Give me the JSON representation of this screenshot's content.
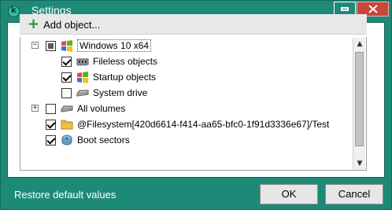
{
  "window": {
    "title": "Settings"
  },
  "toolbar": {
    "add_label": "Add object..."
  },
  "tree": {
    "items": [
      {
        "label": "Windows 10 x64",
        "check": "partial",
        "expander": "-",
        "icon": "windows-flag-icon",
        "selected": true
      },
      {
        "label": "Fileless objects",
        "check": "checked",
        "icon": "memory-chip-icon"
      },
      {
        "label": "Startup objects",
        "check": "checked",
        "icon": "windows-flag-icon"
      },
      {
        "label": "System drive",
        "check": "unchecked",
        "icon": "hard-drive-icon"
      },
      {
        "label": "All volumes",
        "check": "unchecked",
        "expander": "+",
        "icon": "hard-drive-icon"
      },
      {
        "label": "@Filesystem[420d6614-f414-aa65-bfc0-1f91d3336e67]/Test",
        "check": "checked",
        "icon": "folder-icon"
      },
      {
        "label": "Boot sectors",
        "check": "checked",
        "icon": "disk-boot-icon"
      }
    ]
  },
  "footer": {
    "restore_label": "Restore default values",
    "ok_label": "OK",
    "cancel_label": "Cancel"
  },
  "colors": {
    "accent": "#1d8a77",
    "close": "#c8473a",
    "add_plus": "#1e8f3a"
  }
}
